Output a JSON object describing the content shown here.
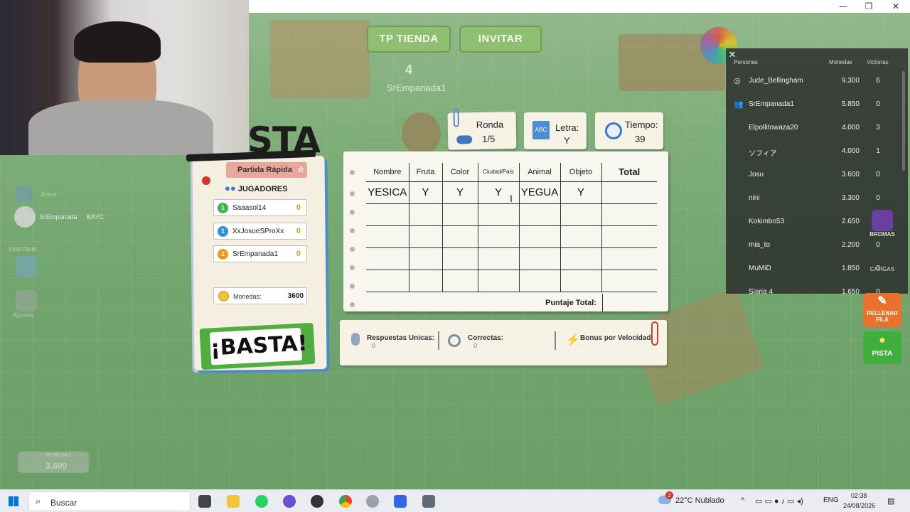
{
  "window": {
    "minimize": "—",
    "maximize": "❐",
    "close": "✕"
  },
  "topbar": {
    "shop_button": "TP TIENDA",
    "invite_button": "INVITAR",
    "player_number": "4",
    "player_tag": "SrEmpanada1"
  },
  "status": {
    "round_label": "Ronda",
    "round_value": "1/5",
    "letter_label": "Letra:",
    "letter_value": "Y",
    "time_label": "Tiempo:",
    "time_value": "39"
  },
  "left_panel": {
    "title": "STA",
    "mode": "Partida Rápida",
    "players_heading": "JUGADORES",
    "players": [
      {
        "rank": "1",
        "name": "Saaasol14",
        "score": "0",
        "color": "#3bb34a"
      },
      {
        "rank": "1",
        "name": "XxJosueSProXx",
        "score": "0",
        "color": "#2f8fd8"
      },
      {
        "rank": "1",
        "name": "SrEmpanada1",
        "score": "0",
        "color": "#e79c12"
      }
    ],
    "coins_label": "Monedas:",
    "coins_value": "3600",
    "basta_button": "¡BASTA!"
  },
  "sheet": {
    "columns": [
      "Nombre",
      "Fruta",
      "Color",
      "Ciudad/País",
      "Animal",
      "Objeto",
      "Total"
    ],
    "entry": [
      "YESICA",
      "Y",
      "Y",
      "Y",
      "YEGUA",
      "Y",
      ""
    ],
    "total_label": "Puntaje Total:"
  },
  "info_bar": {
    "unique_label": "Respuestas Unicas:",
    "unique_value": "0",
    "correct_label": "Correctas:",
    "correct_value": "0",
    "bonus_label": "Bonus por Velocidad:",
    "bonus_value": "-"
  },
  "leaderboard": {
    "close": "✕",
    "headers": {
      "people": "Personas",
      "coins": "Monedas",
      "wins": "Victorias"
    },
    "rows": [
      {
        "name": "Jude_Bellingham",
        "coins": "9.300",
        "wins": "6",
        "icon": "◎"
      },
      {
        "name": "SrEmpanada1",
        "coins": "5.850",
        "wins": "0",
        "icon": "👥"
      },
      {
        "name": "Elpollitowaza20",
        "coins": "4.000",
        "wins": "3",
        "icon": ""
      },
      {
        "name": "ソフィア",
        "coins": "4.000",
        "wins": "1",
        "icon": ""
      },
      {
        "name": "Josu",
        "coins": "3.600",
        "wins": "0",
        "icon": ""
      },
      {
        "name": "nini",
        "coins": "3.300",
        "wins": "0",
        "icon": ""
      },
      {
        "name": "Kokimbo53",
        "coins": "2.650",
        "wins": "1",
        "icon": ""
      },
      {
        "name": "mia_to",
        "coins": "2.200",
        "wins": "0",
        "icon": ""
      },
      {
        "name": "MuMiD",
        "coins": "1.850",
        "wins": "0",
        "icon": ""
      },
      {
        "name": "Siaria 4",
        "coins": "1.650",
        "wins": "0",
        "icon": ""
      }
    ]
  },
  "side_buttons": {
    "pranks": "BROMAS",
    "loads": "CARGAS",
    "fill_row": "RELLENAR FILA",
    "hint": "PISTA"
  },
  "left_hud": {
    "friend": "Josue",
    "player": "SrEmpanada",
    "group": "BAYC",
    "inventory": "Inventario",
    "settings": "Ajustes",
    "coins_label": "MONEDAS",
    "coins_value": "3,600"
  },
  "taskbar": {
    "search_placeholder": "Buscar",
    "weather": "22°C  Nublado",
    "language": "ENG",
    "time": "02:38",
    "date": "24/08/2026",
    "notification_count": "2"
  },
  "colors": {
    "accent_green": "#4fae3f",
    "leaderboard_bg": "#282828",
    "sheet_bg": "#f8f6ef"
  }
}
